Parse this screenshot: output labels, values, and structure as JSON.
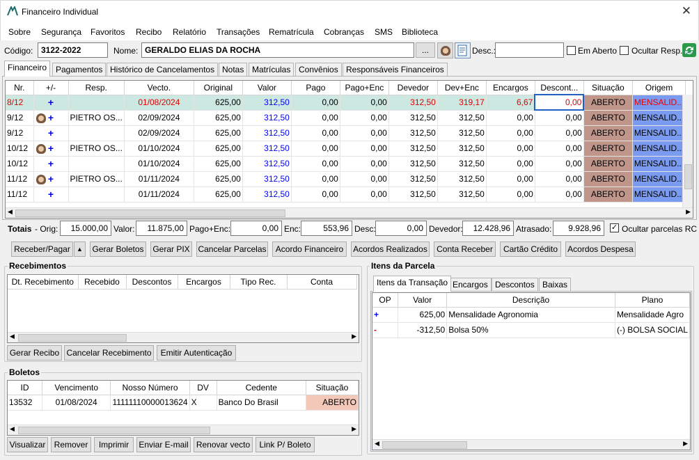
{
  "window": {
    "title": "Financeiro Individual",
    "close": "✕"
  },
  "menu": [
    "Sobre",
    "Segurança",
    "Favoritos",
    "Recibo",
    "Relatório",
    "Transações",
    "Rematrícula",
    "Cobranças",
    "SMS",
    "Biblioteca"
  ],
  "header": {
    "codigo_label": "Código:",
    "codigo": "3122-2022",
    "nome_label": "Nome:",
    "nome": "GERALDO ELIAS DA ROCHA",
    "ellipsis": "...",
    "desc_label": "Desc.:",
    "desc": "",
    "em_aberto": "Em Aberto",
    "ocultar_resp": "Ocultar Resp."
  },
  "tabs": [
    "Financeiro",
    "Pagamentos",
    "Histórico de Cancelamentos",
    "Notas",
    "Matrículas",
    "Convênios",
    "Responsáveis Financeiros"
  ],
  "grid": {
    "headers": [
      "Nr.",
      "+/-",
      "Resp.",
      "Vecto.",
      "Original",
      "Valor",
      "Pago",
      "Pago+Enc",
      "Devedor",
      "Dev+Enc",
      "Encargos",
      "Descont...",
      "Situação",
      "Origem"
    ],
    "rows": [
      [
        "8/12",
        "+",
        "",
        "01/08/2024",
        "625,00",
        "312,50",
        "0,00",
        "0,00",
        "312,50",
        "319,17",
        "6,67",
        "0,00",
        "ABERTO",
        "MENSALID..."
      ],
      [
        "9/12",
        "+",
        "PIETRO OS...",
        "02/09/2024",
        "625,00",
        "312,50",
        "0,00",
        "0,00",
        "312,50",
        "312,50",
        "0,00",
        "0,00",
        "ABERTO",
        "MENSALID..."
      ],
      [
        "9/12",
        "+",
        "",
        "02/09/2024",
        "625,00",
        "312,50",
        "0,00",
        "0,00",
        "312,50",
        "312,50",
        "0,00",
        "0,00",
        "ABERTO",
        "MENSALID..."
      ],
      [
        "10/12",
        "+",
        "PIETRO OS...",
        "01/10/2024",
        "625,00",
        "312,50",
        "0,00",
        "0,00",
        "312,50",
        "312,50",
        "0,00",
        "0,00",
        "ABERTO",
        "MENSALID..."
      ],
      [
        "10/12",
        "+",
        "",
        "01/10/2024",
        "625,00",
        "312,50",
        "0,00",
        "0,00",
        "312,50",
        "312,50",
        "0,00",
        "0,00",
        "ABERTO",
        "MENSALID..."
      ],
      [
        "11/12",
        "+",
        "PIETRO OS...",
        "01/11/2024",
        "625,00",
        "312,50",
        "0,00",
        "0,00",
        "312,50",
        "312,50",
        "0,00",
        "0,00",
        "ABERTO",
        "MENSALID..."
      ],
      [
        "11/12",
        "+",
        "",
        "01/11/2024",
        "625,00",
        "312,50",
        "0,00",
        "0,00",
        "312,50",
        "312,50",
        "0,00",
        "0,00",
        "ABERTO",
        "MENSALID..."
      ]
    ]
  },
  "totais": {
    "label": "Totais",
    "orig_label": "- Orig:",
    "orig": "15.000,00",
    "valor_label": "Valor:",
    "valor": "11.875,00",
    "pagoenc_label": "Pago+Enc:",
    "pagoenc": "0,00",
    "enc_label": "Enc:",
    "enc": "553,96",
    "desc_label": "Desc:",
    "desc": "0,00",
    "devedor_label": "Devedor:",
    "devedor": "12.428,96",
    "atrasado_label": "Atrasado:",
    "atrasado": "9.928,96",
    "ocultar": "Ocultar parcelas RC"
  },
  "actions": [
    "Receber/Pagar",
    "Gerar Boletos",
    "Gerar PIX",
    "Cancelar Parcelas",
    "Acordo Financeiro",
    "Acordos Realizados",
    "Conta Receber",
    "Cartão Crédito",
    "Acordos Despesa"
  ],
  "recebimentos": {
    "title": "Recebimentos",
    "headers": [
      "Dt. Recebimento",
      "Recebido",
      "Descontos",
      "Encargos",
      "Tipo Rec.",
      "Conta"
    ],
    "buttons": [
      "Gerar Recibo",
      "Cancelar Recebimento",
      "Emitir Autenticação"
    ]
  },
  "boletos": {
    "title": "Boletos",
    "headers": [
      "ID",
      "Vencimento",
      "Nosso Número",
      "DV",
      "Cedente",
      "Situação"
    ],
    "rows": [
      [
        "13532",
        "01/08/2024",
        "11111110000013624",
        "X",
        "Banco Do Brasil",
        "ABERTO"
      ]
    ],
    "buttons": [
      "Visualizar",
      "Remover",
      "Imprimir",
      "Enviar E-mail",
      "Renovar vecto",
      "Link P/ Boleto"
    ]
  },
  "itens": {
    "title": "Itens da Parcela",
    "tabs": [
      "Itens da Transação",
      "Encargos",
      "Descontos",
      "Baixas"
    ],
    "headers": [
      "OP",
      "Valor",
      "Descrição",
      "Plano"
    ],
    "rows": [
      [
        "+",
        "625,00",
        "Mensalidade Agronomia",
        "Mensalidade Agro"
      ],
      [
        "-",
        "-312,50",
        "Bolsa 50%",
        "(-) BOLSA SOCIAL"
      ]
    ]
  },
  "colors": {
    "situacao": "#c0968b",
    "origem": "#7b9bf0",
    "selected_row": "#cce8e0",
    "boleto_situacao": "#f4c8b8"
  }
}
